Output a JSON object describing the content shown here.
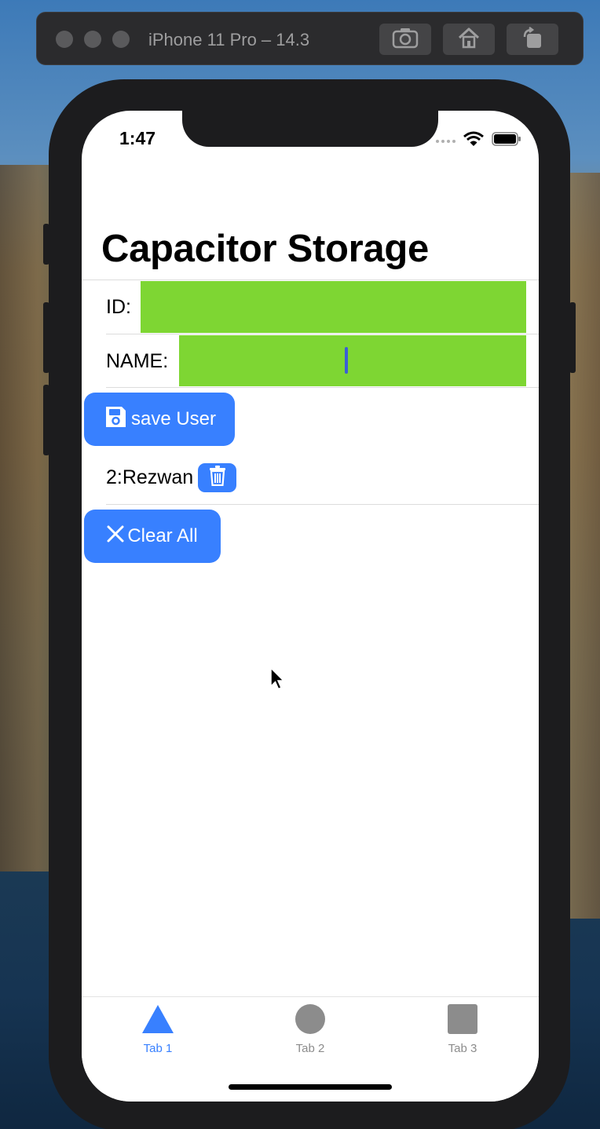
{
  "simulator": {
    "title": "iPhone 11 Pro – 14.3",
    "buttons": [
      "screenshot-icon",
      "home-icon",
      "rotate-icon"
    ]
  },
  "status_bar": {
    "time": "1:47",
    "icons": [
      "cellular-dots-icon",
      "wifi-icon",
      "battery-icon"
    ]
  },
  "page": {
    "title": "Capacitor Storage"
  },
  "form": {
    "id_label": "ID:",
    "id_value": "",
    "name_label": "NAME:",
    "name_value": "",
    "save_button_label": "save User"
  },
  "users": [
    {
      "text": "2:Rezwan"
    }
  ],
  "clear_button_label": "Clear All",
  "tabs": [
    {
      "label": "Tab 1",
      "icon": "triangle-icon",
      "active": true
    },
    {
      "label": "Tab 2",
      "icon": "circle-icon",
      "active": false
    },
    {
      "label": "Tab 3",
      "icon": "square-icon",
      "active": false
    }
  ],
  "colors": {
    "primary": "#3880ff",
    "input_bg": "#7ed633",
    "tab_active": "#3880ff",
    "tab_inactive": "#8c8c8c"
  }
}
